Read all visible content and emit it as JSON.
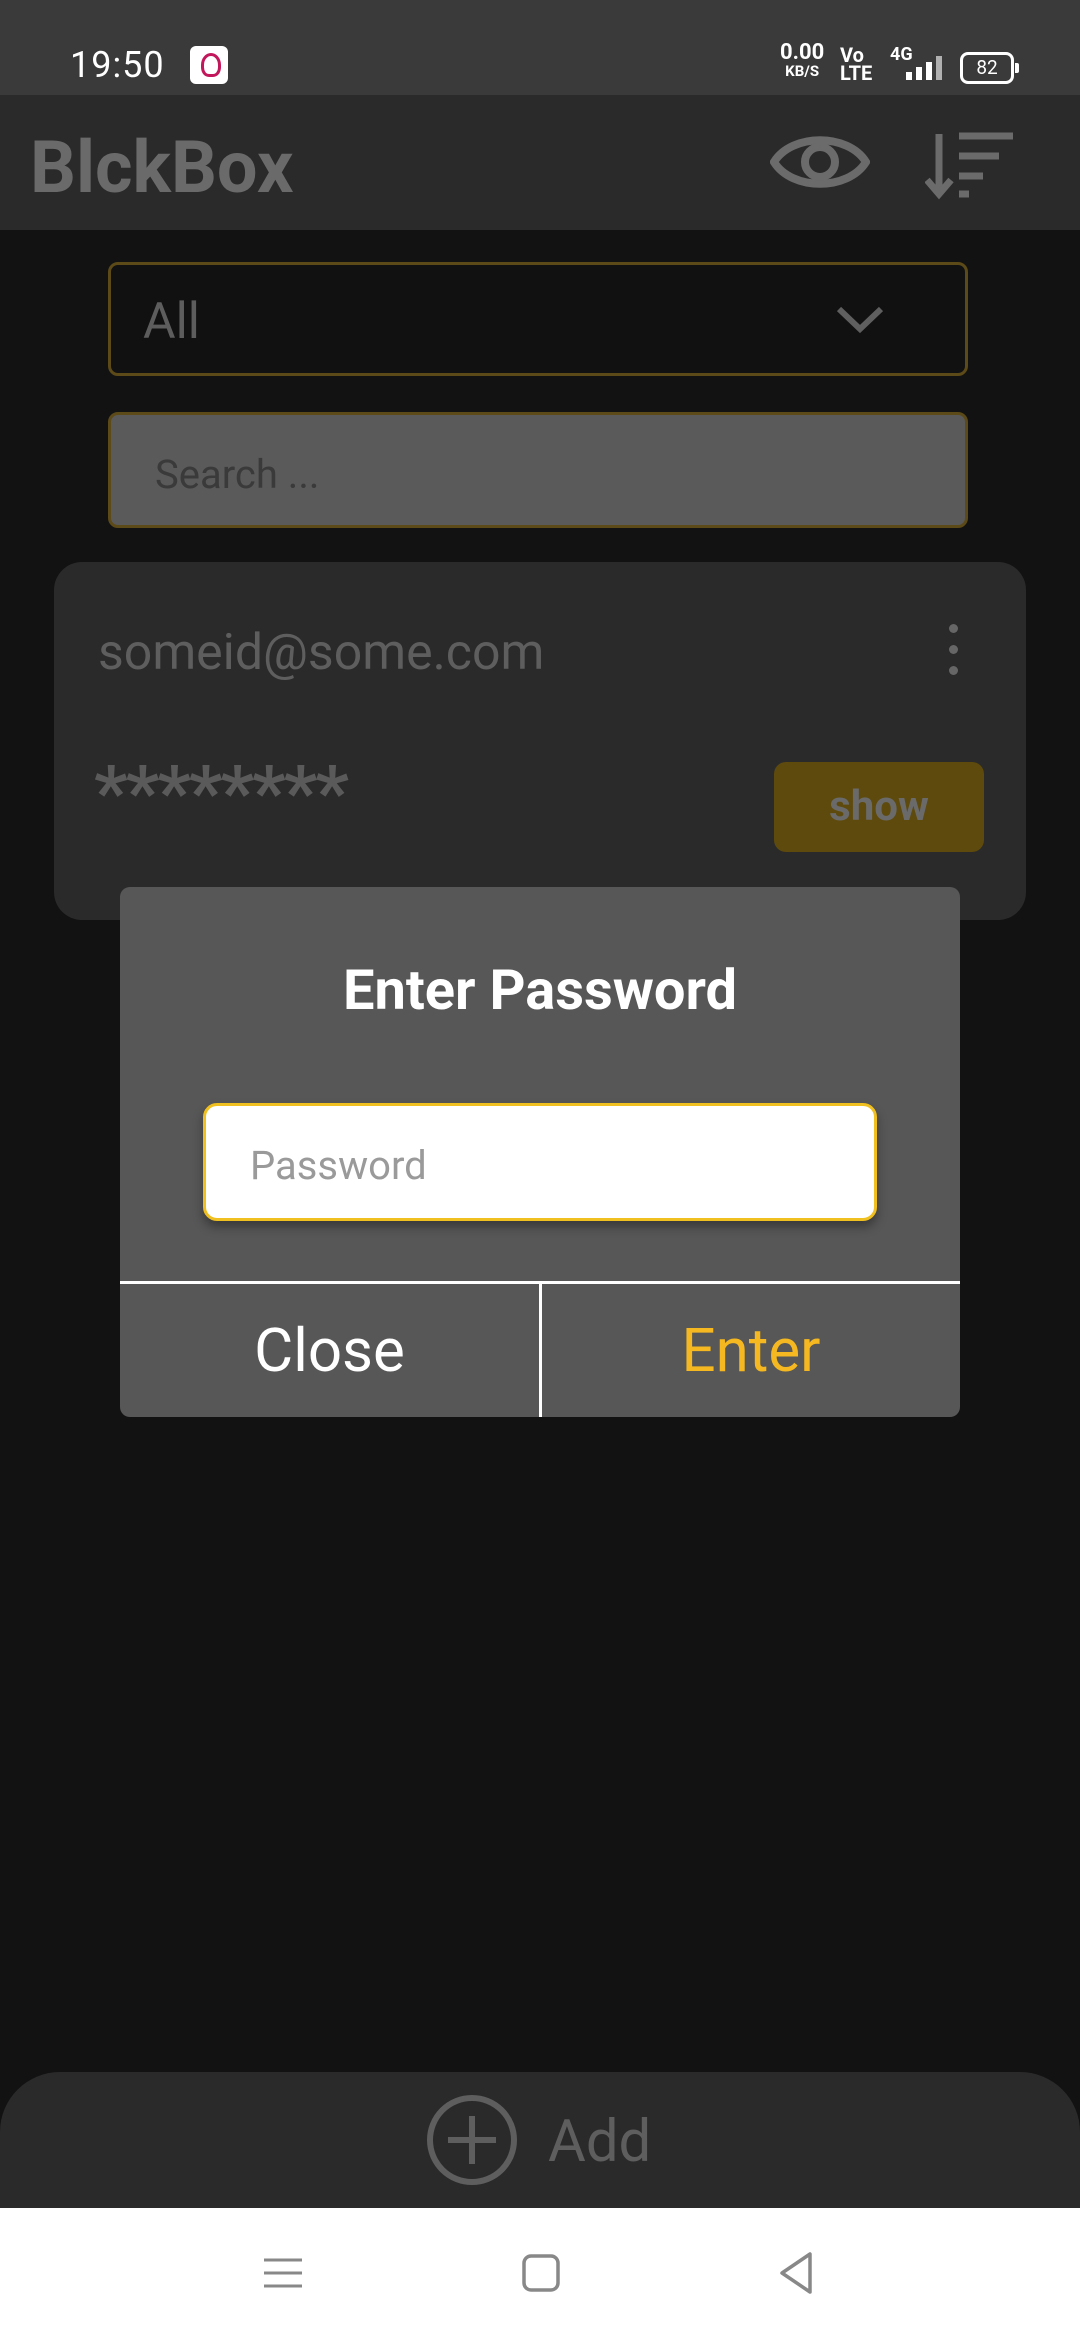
{
  "status_bar": {
    "time": "19:50",
    "net_speed_value": "0.00",
    "net_speed_unit": "KB/S",
    "volte_top": "Vo",
    "volte_bottom": "LTE",
    "network": "4G",
    "battery": "82"
  },
  "app_bar": {
    "title": "BlckBox",
    "icons": [
      "eye-icon",
      "sort-icon"
    ]
  },
  "filter": {
    "selected": "All"
  },
  "search": {
    "placeholder": "Search ..."
  },
  "entry": {
    "email": "someid@some.com",
    "masked_password": "********",
    "show_label": "show"
  },
  "dialog": {
    "title": "Enter Password",
    "password_placeholder": "Password",
    "close_label": "Close",
    "enter_label": "Enter"
  },
  "bottom_bar": {
    "add_label": "Add"
  },
  "colors": {
    "accent": "#f5b820",
    "background": "#121212",
    "dialog": "#575757"
  }
}
